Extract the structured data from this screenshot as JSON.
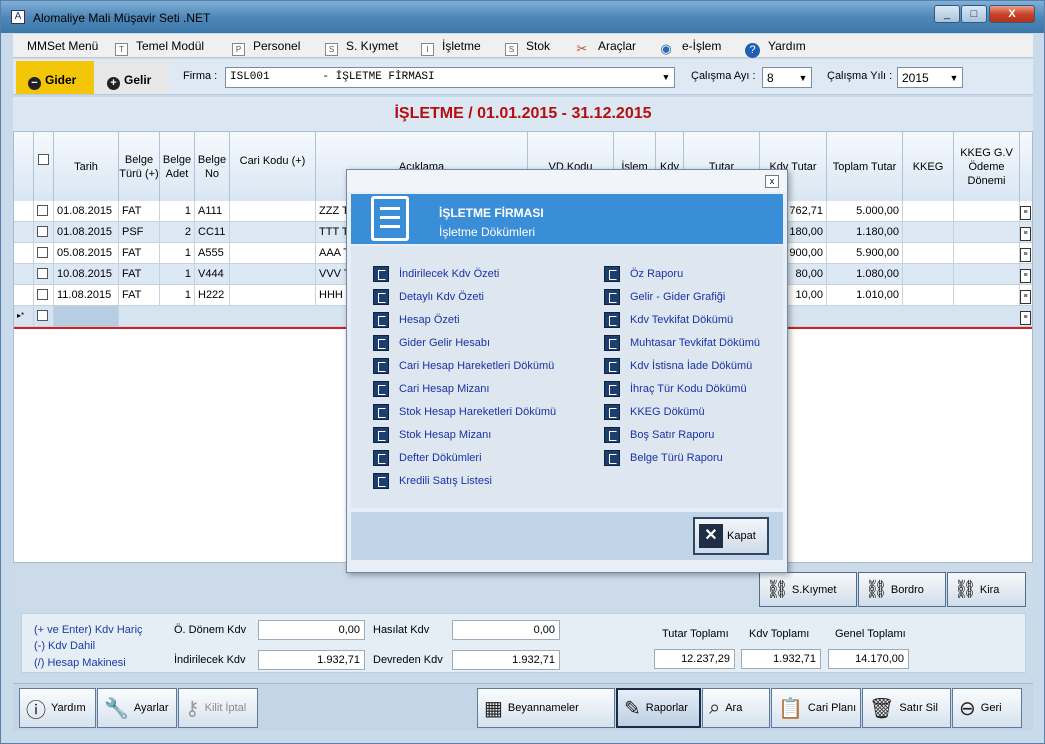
{
  "window": {
    "title": "Alomaliye Mali Müşavir Seti .NET",
    "min": "_",
    "max": "□",
    "close": "X"
  },
  "menu": [
    {
      "label": "MMSet Menü",
      "icon": ""
    },
    {
      "label": "Temel Modül",
      "icon": "T"
    },
    {
      "label": "Personel",
      "icon": "P"
    },
    {
      "label": "S. Kıymet",
      "icon": "S"
    },
    {
      "label": "İşletme",
      "icon": "I"
    },
    {
      "label": "Stok",
      "icon": "S"
    },
    {
      "label": "Araçlar",
      "icon": "tools-icon"
    },
    {
      "label": "e-İşlem",
      "icon": "globe-icon"
    },
    {
      "label": "Yardım",
      "icon": "help-icon"
    }
  ],
  "toolbar": {
    "gider": "Gider",
    "gelir": "Gelir",
    "firma_label": "Firma :",
    "firma_value": "ISL001        - İŞLETME FİRMASI",
    "ay_label": "Çalışma Ayı :",
    "ay_value": "8",
    "yil_label": "Çalışma Yılı :",
    "yil_value": "2015"
  },
  "page_title": "İŞLETME / 01.01.2015 - 31.12.2015",
  "grid": {
    "headers": [
      "Tarih",
      "Belge Türü (+)",
      "Belge Adet",
      "Belge No",
      "Cari Kodu (+)",
      "Açıklama",
      "VD Kodu",
      "İşlem",
      "Kdv",
      "Tutar",
      "Kdv Tutar",
      "Toplam Tutar",
      "KKEG",
      "KKEG G.V Ödeme Dönemi"
    ],
    "rows": [
      {
        "tarih": "01.08.2015",
        "tur": "FAT",
        "adet": "1",
        "no": "A111",
        "aciklama": "ZZZ T",
        "kdv": "762,71",
        "toplam": "5.000,00"
      },
      {
        "tarih": "01.08.2015",
        "tur": "PSF",
        "adet": "2",
        "no": "CC11",
        "aciklama": "TTT Tİ",
        "kdv": "180,00",
        "toplam": "1.180,00"
      },
      {
        "tarih": "05.08.2015",
        "tur": "FAT",
        "adet": "1",
        "no": "A555",
        "aciklama": "AAA T",
        "kdv": "900,00",
        "toplam": "5.900,00"
      },
      {
        "tarih": "10.08.2015",
        "tur": "FAT",
        "adet": "1",
        "no": "V444",
        "aciklama": "VVV T",
        "kdv": "80,00",
        "toplam": "1.080,00"
      },
      {
        "tarih": "11.08.2015",
        "tur": "FAT",
        "adet": "1",
        "no": "H222",
        "aciklama": "HHH T",
        "kdv": "10,00",
        "toplam": "1.010,00"
      }
    ],
    "newrow_marker": "▸*"
  },
  "side_buttons": {
    "skiymet": "S.Kıymet",
    "bordro": "Bordro",
    "kira": "Kira"
  },
  "kdv": {
    "hint1": "(+ ve Enter) Kdv Hariç",
    "hint2": "(-)  Kdv Dahil",
    "hint3": "(/) Hesap Makinesi",
    "odonem_label": "Ö. Dönem Kdv",
    "odonem_value": "0,00",
    "hasilat_label": "Hasılat Kdv",
    "hasilat_value": "0,00",
    "indirilecek_label": "İndirilecek Kdv",
    "indirilecek_value": "1.932,71",
    "devreden_label": "Devreden Kdv",
    "devreden_value": "1.932,71",
    "tutar_label": "Tutar Toplamı",
    "tutar_value": "12.237,29",
    "kdvtop_label": "Kdv Toplamı",
    "kdvtop_value": "1.932,71",
    "genel_label": "Genel Toplamı",
    "genel_value": "14.170,00"
  },
  "footer": {
    "yardim": "Yardım",
    "ayarlar": "Ayarlar",
    "kilit": "Kilit İptal",
    "beyan": "Beyannameler",
    "raporlar": "Raporlar",
    "ara": "Ara",
    "cari": "Cari Planı",
    "satirsil": "Satır Sil",
    "geri": "Geri"
  },
  "dialog": {
    "close": "x",
    "title": "İŞLETME FİRMASI",
    "subtitle": "İşletme Dökümleri",
    "left": [
      "İndirilecek Kdv Özeti",
      "Detaylı Kdv Özeti",
      "Hesap Özeti",
      "Gider Gelir Hesabı",
      "Cari Hesap Hareketleri Dökümü",
      "Cari Hesap Mizanı",
      "Stok Hesap Hareketleri Dökümü",
      "Stok Hesap Mizanı",
      "Defter Dökümleri",
      "Kredili Satış Listesi"
    ],
    "right": [
      "Öz Raporu",
      "Gelir - Gider Grafiği",
      "Kdv Tevkifat Dökümü",
      "Muhtasar Tevkifat Dökümü",
      "Kdv İstisna İade Dökümü",
      "İhraç Tür Kodu Dökümü",
      "KKEG Dökümü",
      "Boş Satır Raporu",
      "Belge Türü Raporu"
    ],
    "kapat": "Kapat"
  }
}
